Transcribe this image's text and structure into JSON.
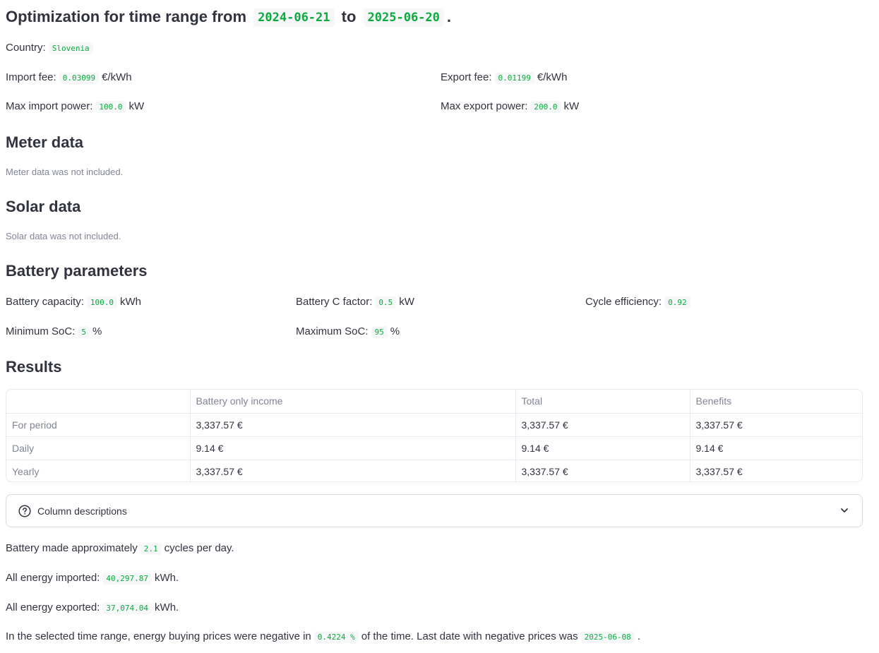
{
  "header": {
    "title_prefix": "Optimization for time range from",
    "start_date": "2024-06-21",
    "to_word": "to",
    "end_date": "2025-06-20",
    "end_dot": "."
  },
  "country": {
    "label": "Country:",
    "value": "Slovenia"
  },
  "fees": {
    "import_label": "Import fee:",
    "import_value": "0.03099",
    "import_unit": "€/kWh",
    "export_label": "Export fee:",
    "export_value": "0.01199",
    "export_unit": "€/kWh"
  },
  "power": {
    "max_import_label": "Max import power:",
    "max_import_value": "100.0",
    "max_import_unit": "kW",
    "max_export_label": "Max export power:",
    "max_export_value": "200.0",
    "max_export_unit": "kW"
  },
  "meter": {
    "heading": "Meter data",
    "note": "Meter data was not included."
  },
  "solar": {
    "heading": "Solar data",
    "note": "Solar data was not included."
  },
  "battery": {
    "heading": "Battery parameters",
    "capacity_label": "Battery capacity:",
    "capacity_value": "100.0",
    "capacity_unit": "kWh",
    "c_factor_label": "Battery C factor:",
    "c_factor_value": "0.5",
    "c_factor_unit": "kW",
    "cycle_eff_label": "Cycle efficiency:",
    "cycle_eff_value": "0.92",
    "min_soc_label": "Minimum SoC:",
    "min_soc_value": "5",
    "min_soc_unit": "%",
    "max_soc_label": "Maximum SoC:",
    "max_soc_value": "95",
    "max_soc_unit": "%"
  },
  "results": {
    "heading": "Results",
    "columns": [
      "",
      "Battery only income",
      "Total",
      "Benefits"
    ],
    "rows": [
      {
        "label": "For period",
        "cells": [
          "3,337.57 €",
          "3,337.57 €",
          "3,337.57 €"
        ]
      },
      {
        "label": "Daily",
        "cells": [
          "9.14 €",
          "9.14 €",
          "9.14 €"
        ]
      },
      {
        "label": "Yearly",
        "cells": [
          "3,337.57 €",
          "3,337.57 €",
          "3,337.57 €"
        ]
      }
    ]
  },
  "expander": {
    "label": "Column descriptions",
    "icon": "help-circle-icon",
    "chevron": "chevron-down-icon"
  },
  "summary": {
    "cycles_prefix": "Battery made approximately",
    "cycles_value": "2.1",
    "cycles_suffix": "cycles per day.",
    "imported_prefix": "All energy imported:",
    "imported_value": "40,297.87",
    "imported_suffix": "kWh.",
    "exported_prefix": "All energy exported:",
    "exported_value": "37,074.04",
    "exported_suffix": "kWh.",
    "negative_prefix": "In the selected time range, energy buying prices were negative in",
    "negative_value": "0.4224 %",
    "negative_mid": "of the time. Last date with negative prices was",
    "negative_date": "2025-06-08",
    "negative_suffix": "."
  },
  "colors": {
    "text": "#31333f",
    "muted": "#808495",
    "code_green": "#09ab3b",
    "code_bg": "#f6f7f9",
    "border": "#e6e9ef"
  }
}
